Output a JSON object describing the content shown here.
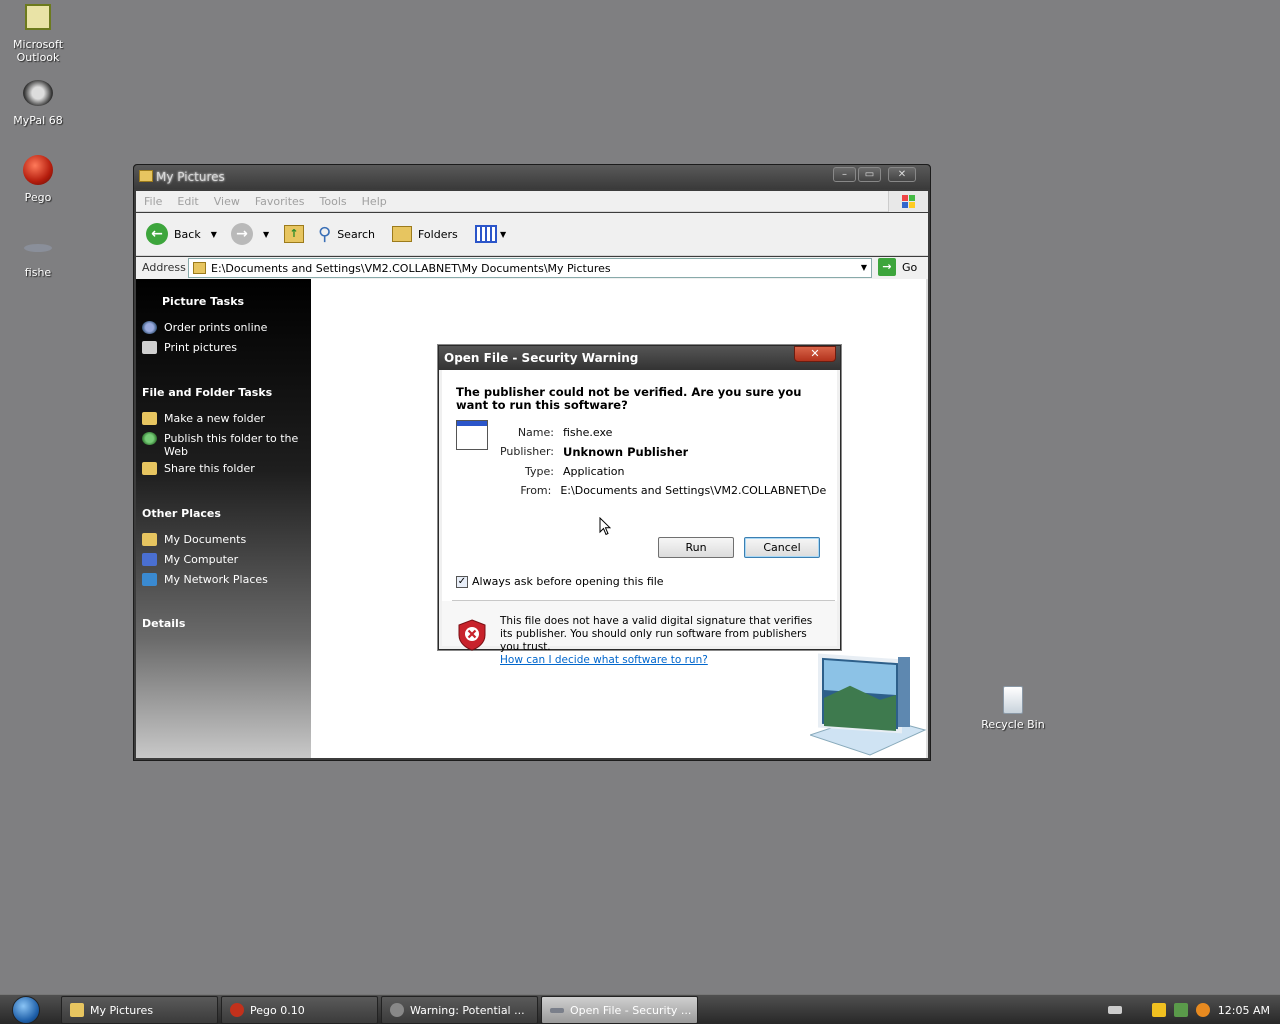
{
  "desktop": {
    "icons": [
      {
        "label": "Microsoft Outlook",
        "icon": "outlook-icon"
      },
      {
        "label": "MyPal 68",
        "icon": "mypal-icon"
      },
      {
        "label": "Pego",
        "icon": "pego-icon"
      },
      {
        "label": "fishe",
        "icon": "fish-icon"
      },
      {
        "label": "Recycle Bin",
        "icon": "recycle-bin-icon"
      }
    ]
  },
  "explorer": {
    "title": "My Pictures",
    "menu": [
      "File",
      "Edit",
      "View",
      "Favorites",
      "Tools",
      "Help"
    ],
    "toolbar": {
      "back": "Back",
      "search": "Search",
      "folders": "Folders"
    },
    "address": {
      "label": "Address",
      "value": "E:\\Documents and Settings\\VM2.COLLABNET\\My Documents\\My Pictures",
      "go": "Go"
    },
    "picture_tasks": {
      "heading": "Picture Tasks",
      "items": [
        "Order prints online",
        "Print pictures"
      ]
    },
    "file_folder_tasks": {
      "heading": "File and Folder Tasks",
      "items": [
        "Make a new folder",
        "Publish this folder to the Web",
        "Share this folder"
      ]
    },
    "other_places": {
      "heading": "Other Places",
      "items": [
        "My Documents",
        "My Computer",
        "My Network Places"
      ]
    },
    "details": {
      "heading": "Details"
    }
  },
  "dialog": {
    "title": "Open File - Security Warning",
    "question": "The publisher could not be verified.  Are you sure you want to run this software?",
    "fields": {
      "name_label": "Name:",
      "name": "fishe.exe",
      "publisher_label": "Publisher:",
      "publisher": "Unknown Publisher",
      "type_label": "Type:",
      "type": "Application",
      "from_label": "From:",
      "from": "E:\\Documents and Settings\\VM2.COLLABNET\\De..."
    },
    "run": "Run",
    "cancel": "Cancel",
    "checkbox": {
      "label": "Always ask before opening this file",
      "checked": true
    },
    "warning": "This file does not have a valid digital signature that verifies its publisher.  You should only run software from publishers you trust.",
    "link": "How can I decide what software to run?"
  },
  "taskbar": {
    "tasks": [
      "My Pictures",
      "Pego 0.10",
      "Warning: Potential ...",
      "Open File - Security ..."
    ],
    "clock": "12:05 AM"
  }
}
